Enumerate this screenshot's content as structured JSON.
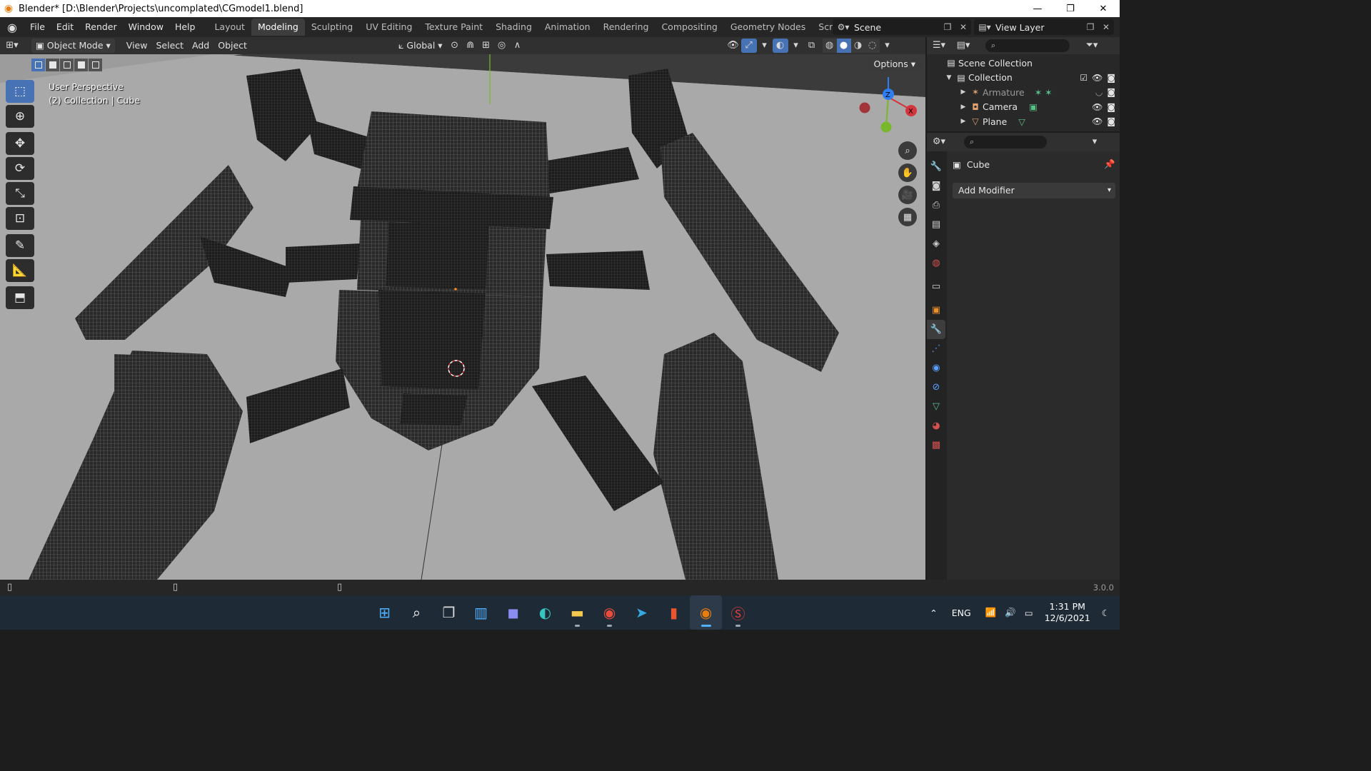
{
  "window": {
    "title": "Blender* [D:\\Blender\\Projects\\uncomplated\\CGmodel1.blend]",
    "controls": [
      "—",
      "❐",
      "✕"
    ]
  },
  "menus": [
    "File",
    "Edit",
    "Render",
    "Window",
    "Help"
  ],
  "workspaces": [
    {
      "label": "Layout",
      "active": false
    },
    {
      "label": "Modeling",
      "active": true
    },
    {
      "label": "Sculpting",
      "active": false
    },
    {
      "label": "UV Editing",
      "active": false
    },
    {
      "label": "Texture Paint",
      "active": false
    },
    {
      "label": "Shading",
      "active": false
    },
    {
      "label": "Animation",
      "active": false
    },
    {
      "label": "Rendering",
      "active": false
    },
    {
      "label": "Compositing",
      "active": false
    },
    {
      "label": "Geometry Nodes",
      "active": false
    },
    {
      "label": "Scripting",
      "active": false
    }
  ],
  "scene": {
    "label": "Scene"
  },
  "view_layer": {
    "label": "View Layer"
  },
  "viewport_header": {
    "mode": "Object Mode",
    "menus": [
      "View",
      "Select",
      "Add",
      "Object"
    ],
    "orientation": "Global",
    "options_label": "Options"
  },
  "viewport": {
    "perspective": "User Perspective",
    "collection_info": "(2) Collection | Cube",
    "background_color": "#8f8f8f",
    "floor_color": "#a9a9a9",
    "mesh_color": "#2a2a2a"
  },
  "outliner": {
    "root": "Scene Collection",
    "collection": "Collection",
    "items": [
      {
        "label": "Armature",
        "icon": "armature-icon",
        "color": "#e0a070",
        "dim": true
      },
      {
        "label": "Camera",
        "icon": "camera-icon",
        "color": "#e0a070",
        "dim": false
      },
      {
        "label": "Plane",
        "icon": "mesh-icon",
        "color": "#e0a070",
        "dim": false
      }
    ]
  },
  "properties": {
    "object_name": "Cube",
    "add_modifier": "Add Modifier"
  },
  "statusbar": {
    "version": "3.0.0"
  },
  "taskbar": {
    "language": "ENG",
    "time": "1:31 PM",
    "date": "12/6/2021"
  },
  "colors": {
    "accent": "#4772b3",
    "blender_orange": "#e87d0d",
    "axis_x": "#d4353c",
    "axis_y": "#79b82b",
    "axis_z": "#2e7ef2"
  }
}
